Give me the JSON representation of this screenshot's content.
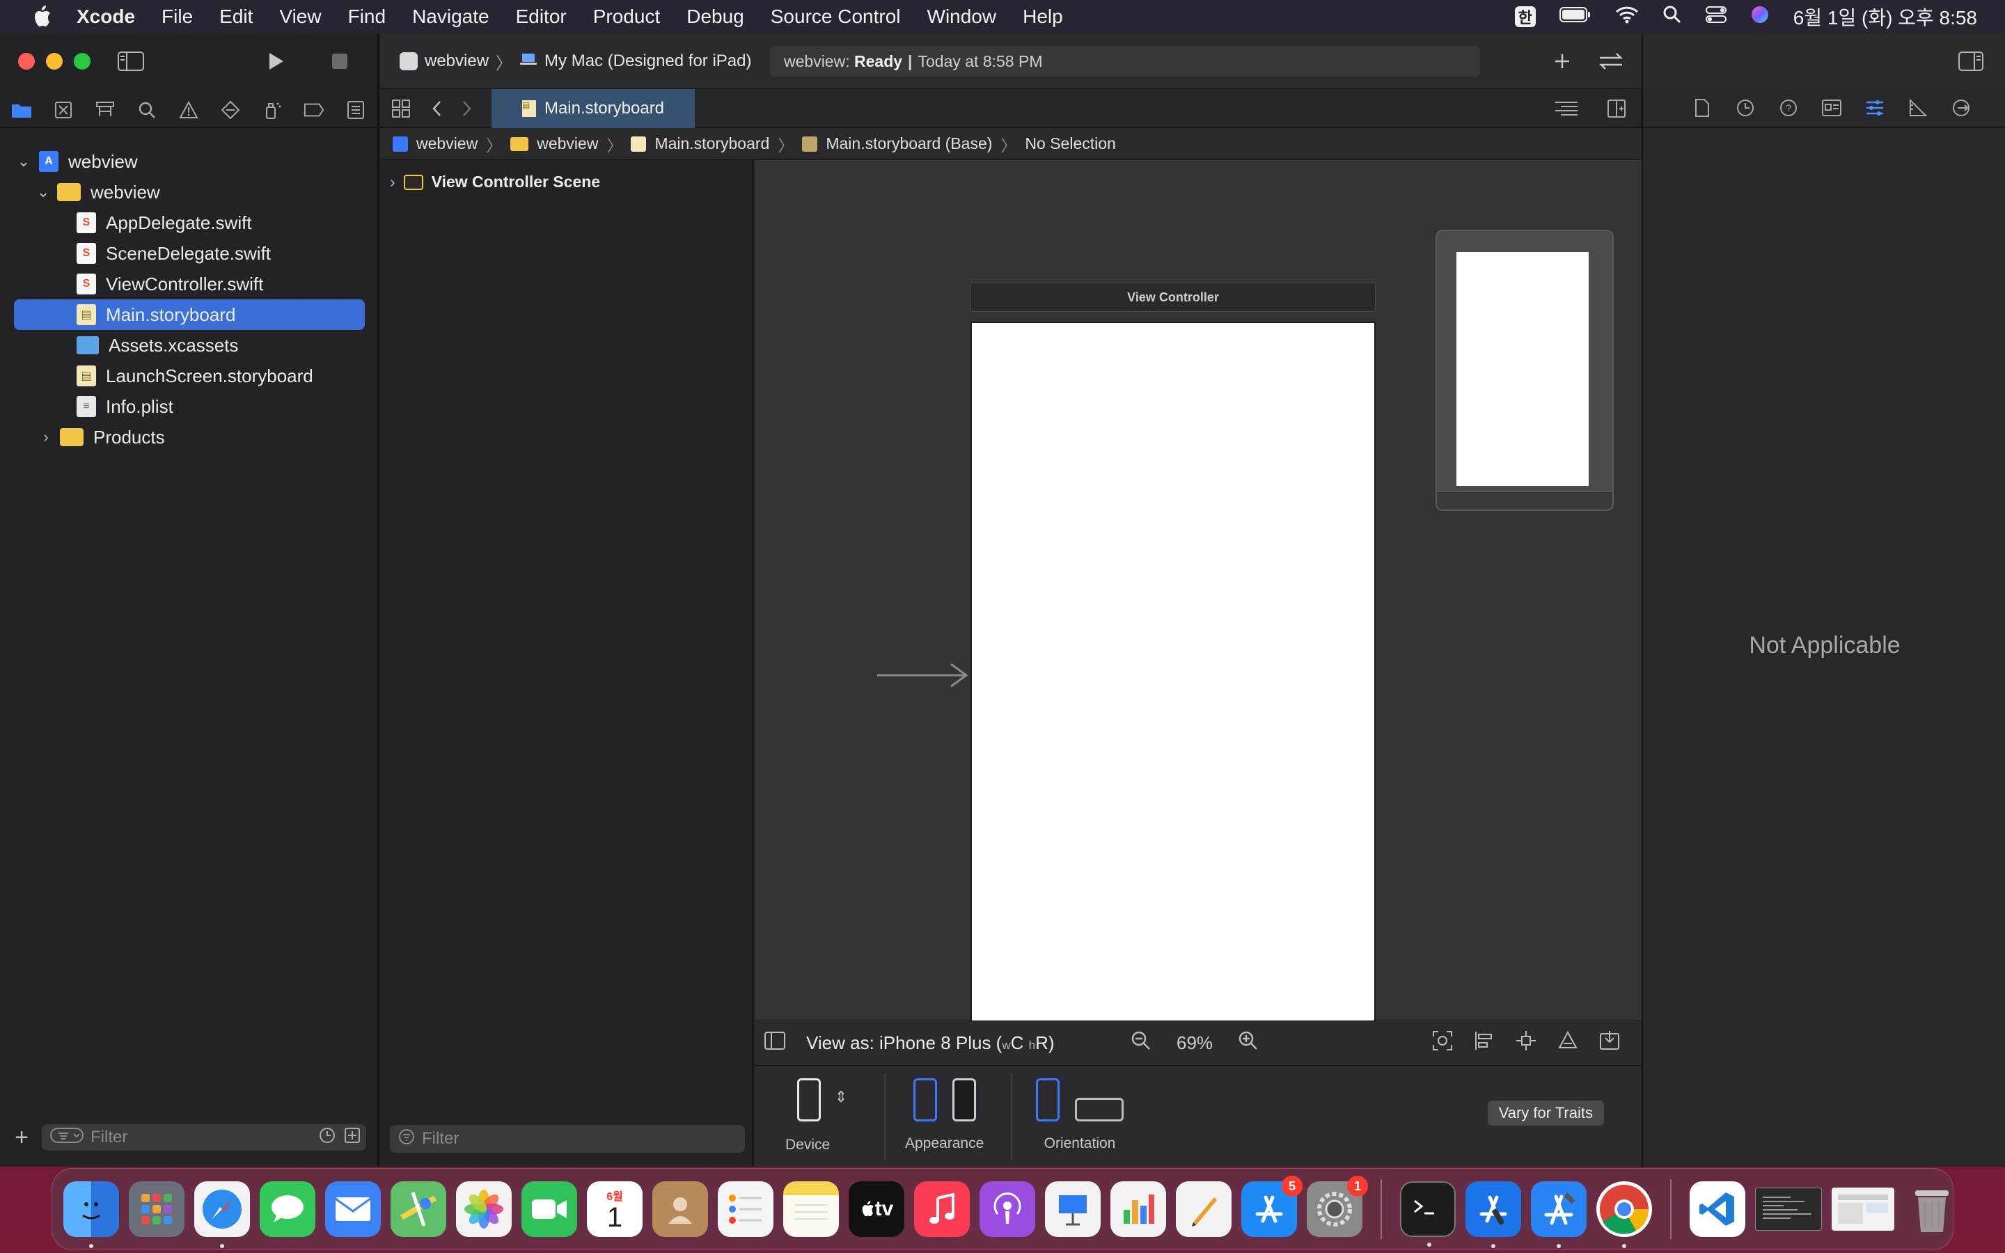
{
  "menubar": {
    "app_name": "Xcode",
    "items": [
      "File",
      "Edit",
      "View",
      "Find",
      "Navigate",
      "Editor",
      "Product",
      "Debug",
      "Source Control",
      "Window",
      "Help"
    ],
    "input_method": "한",
    "datetime": "6월 1일 (화) 오후 8:58"
  },
  "toolbar": {
    "scheme": "webview",
    "destination": "My Mac (Designed for iPad)",
    "activity_project": "webview:",
    "activity_status": "Ready",
    "activity_time": "Today at 8:58 PM"
  },
  "navigator": {
    "tree": [
      {
        "label": "webview",
        "type": "project",
        "level": 0,
        "expanded": true
      },
      {
        "label": "webview",
        "type": "folder",
        "level": 1,
        "expanded": true
      },
      {
        "label": "AppDelegate.swift",
        "type": "swift",
        "level": 2
      },
      {
        "label": "SceneDelegate.swift",
        "type": "swift",
        "level": 2
      },
      {
        "label": "ViewController.swift",
        "type": "swift",
        "level": 2
      },
      {
        "label": "Main.storyboard",
        "type": "storyboard",
        "level": 2,
        "selected": true
      },
      {
        "label": "Assets.xcassets",
        "type": "assets",
        "level": 2
      },
      {
        "label": "LaunchScreen.storyboard",
        "type": "storyboard",
        "level": 2
      },
      {
        "label": "Info.plist",
        "type": "plist",
        "level": 2
      },
      {
        "label": "Products",
        "type": "folder",
        "level": 1,
        "expanded": false
      }
    ],
    "filter_placeholder": "Filter"
  },
  "editor": {
    "active_tab": "Main.storyboard",
    "jumpbar": [
      "webview",
      "webview",
      "Main.storyboard",
      "Main.storyboard (Base)",
      "No Selection"
    ],
    "outline_scene": "View Controller Scene",
    "outline_filter_placeholder": "Filter",
    "view_controller_title": "View Controller",
    "view_as_prefix": "View as: iPhone 8 Plus (",
    "view_as_w": "w",
    "view_as_c": "C",
    "view_as_h": "h",
    "view_as_r": "R",
    "view_as_suffix": ")",
    "zoom": "69%",
    "device_label": "Device",
    "appearance_label": "Appearance",
    "orientation_label": "Orientation",
    "vary_button": "Vary for Traits"
  },
  "inspector": {
    "message": "Not Applicable"
  },
  "dock": {
    "apps": [
      {
        "name": "Finder",
        "color": "#3a8df5"
      },
      {
        "name": "Launchpad",
        "color": "#6b6f7a"
      },
      {
        "name": "Safari",
        "color": "#2d8cf0"
      },
      {
        "name": "Messages",
        "color": "#34c759"
      },
      {
        "name": "Mail",
        "color": "#3b82f6"
      },
      {
        "name": "Maps",
        "color": "#5fbf6a"
      },
      {
        "name": "Photos",
        "color": "#f2f2f2"
      },
      {
        "name": "FaceTime",
        "color": "#30c15b"
      },
      {
        "name": "Calendar",
        "color": "#ffffff"
      },
      {
        "name": "Contacts",
        "color": "#b78a5a"
      },
      {
        "name": "Reminders",
        "color": "#f5f5f5"
      },
      {
        "name": "Notes",
        "color": "#f7d451"
      },
      {
        "name": "TV",
        "color": "#111111"
      },
      {
        "name": "Music",
        "color": "#fa3c55"
      },
      {
        "name": "Podcasts",
        "color": "#9b4de0"
      },
      {
        "name": "Keynote",
        "color": "#2e7cf6"
      },
      {
        "name": "Numbers",
        "color": "#2fbf4a"
      },
      {
        "name": "Pages",
        "color": "#f09a2b"
      },
      {
        "name": "App Store",
        "color": "#1e8bf7",
        "badge": "5"
      },
      {
        "name": "System Preferences",
        "color": "#8a8a8e",
        "badge": "1"
      },
      {
        "name": "Terminal",
        "color": "#1c1c1c"
      },
      {
        "name": "Xcode Instruments",
        "color": "#1d74e8"
      },
      {
        "name": "Xcode",
        "color": "#2a85f4"
      },
      {
        "name": "Chrome",
        "color": "#ffffff"
      },
      {
        "name": "VS Code",
        "color": "#1f7ed6"
      }
    ],
    "calendar_month": "6월",
    "calendar_day": "1",
    "tv_label": "tv"
  }
}
